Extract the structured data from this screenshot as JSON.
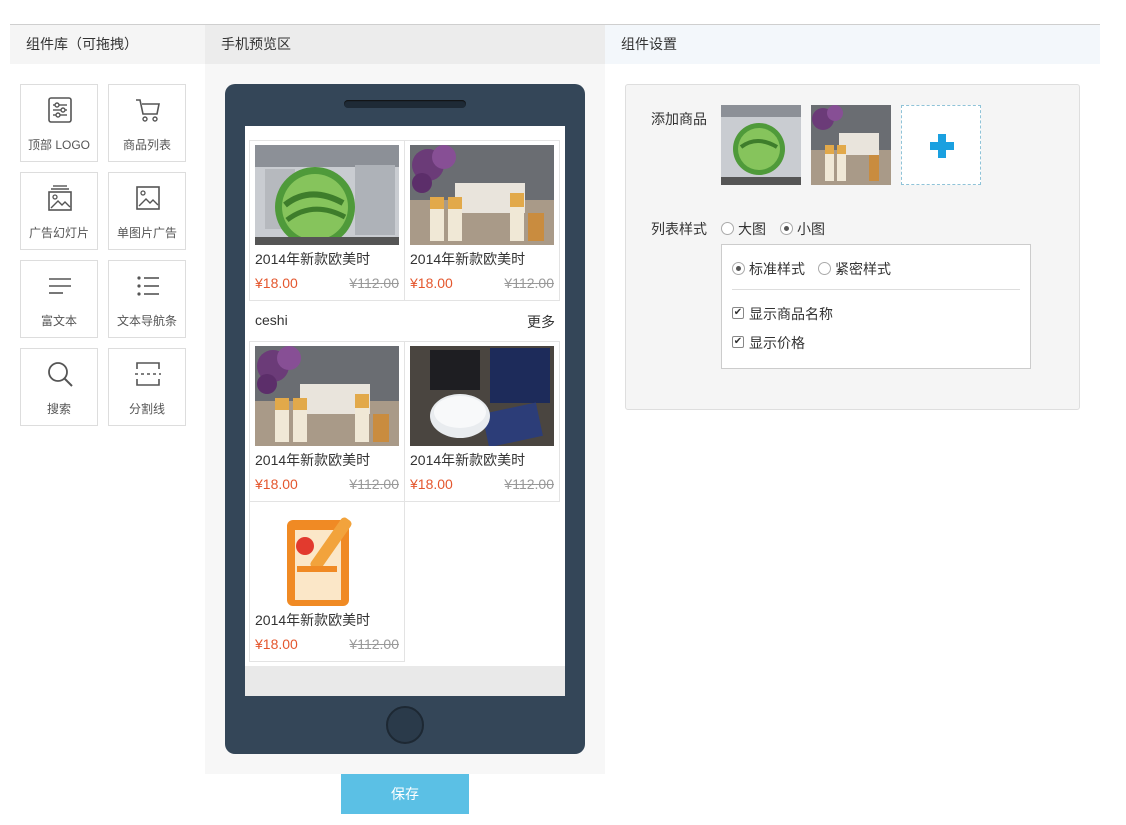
{
  "headers": {
    "library": "组件库（可拖拽）",
    "preview": "手机预览区",
    "settings": "组件设置"
  },
  "library": [
    {
      "label": "顶部 LOGO",
      "icon": "sliders-icon"
    },
    {
      "label": "商品列表",
      "icon": "cart-icon"
    },
    {
      "label": "广告幻灯片",
      "icon": "slideshow-icon"
    },
    {
      "label": "单图片广告",
      "icon": "image-icon"
    },
    {
      "label": "富文本",
      "icon": "richtext-icon"
    },
    {
      "label": "文本导航条",
      "icon": "list-icon"
    },
    {
      "label": "搜索",
      "icon": "search-icon"
    },
    {
      "label": "分割线",
      "icon": "divider-icon"
    }
  ],
  "preview": {
    "group_title": "ceshi",
    "group_more": "更多",
    "products": [
      {
        "name": "2014年新款欧美时",
        "price": "¥18.00",
        "original_price": "¥112.00",
        "image": "aloe-gel"
      },
      {
        "name": "2014年新款欧美时",
        "price": "¥18.00",
        "original_price": "¥112.00",
        "image": "skincare-bottles"
      },
      {
        "name": "2014年新款欧美时",
        "price": "¥18.00",
        "original_price": "¥112.00",
        "image": "skincare-bottles"
      },
      {
        "name": "2014年新款欧美时",
        "price": "¥18.00",
        "original_price": "¥112.00",
        "image": "cushion-compact"
      },
      {
        "name": "2014年新款欧美时",
        "price": "¥18.00",
        "original_price": "¥112.00",
        "image": "collagen-mask"
      }
    ]
  },
  "save_button": "保存",
  "settings": {
    "add_product_label": "添加商品",
    "list_style_label": "列表样式",
    "list_style_options": [
      "大图",
      "小图"
    ],
    "list_style_selected": "小图",
    "display_options": [
      "标准样式",
      "紧密样式"
    ],
    "display_selected": "标准样式",
    "show_name_label": "显示商品名称",
    "show_name_checked": true,
    "show_price_label": "显示价格",
    "show_price_checked": true
  },
  "colors": {
    "price": "#e4572e",
    "save_button": "#5bc0e5",
    "phone_body": "#344658",
    "add_plus": "#1aa0e0"
  }
}
